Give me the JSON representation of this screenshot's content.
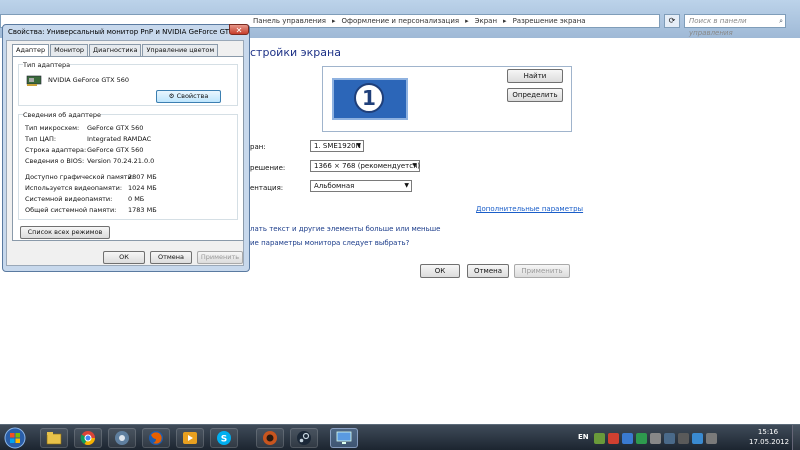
{
  "control_panel": {
    "breadcrumb": [
      "Панель управления",
      "Оформление и персонализация",
      "Экран",
      "Разрешение экрана"
    ],
    "search_placeholder": "Поиск в панели управления",
    "title": "стройки экрана",
    "identify_buttons": {
      "find": "Найти",
      "identify": "Определить"
    },
    "fields": [
      {
        "label": "ран:",
        "value": "1. SME1920N"
      },
      {
        "label": "решение:",
        "value": "1366 × 768 (рекомендуется)"
      },
      {
        "label": "ентация:",
        "value": "Альбомная"
      }
    ],
    "monitor_number": "1",
    "advanced_link": "Дополнительные параметры",
    "link_text_size": "лать текст и другие элементы больше или меньше",
    "link_which_params": "ие параметры монитора следует выбрать?",
    "buttons": {
      "ok": "ОК",
      "cancel": "Отмена",
      "apply": "Применить"
    }
  },
  "dialog": {
    "title": "Свойства: Универсальный монитор PnP и NVIDIA GeForce GTX",
    "close_glyph": "✕",
    "tabs": [
      "Адаптер",
      "Монитор",
      "Диагностика",
      "Управление цветом"
    ],
    "adapter_type_group": "Тип адаптера",
    "adapter_name": "NVIDIA GeForce GTX 560",
    "properties_button": "Свойства",
    "adapter_info_group": "Сведения об адаптере",
    "info": [
      {
        "label": "Тип микросхем:",
        "value": "GeForce GTX 560"
      },
      {
        "label": "Тип ЦАП:",
        "value": "Integrated RAMDAC"
      },
      {
        "label": "Строка адаптера:",
        "value": "GeForce GTX 560"
      },
      {
        "label": "Сведения о BIOS:",
        "value": "Version 70.24.21.0.0"
      }
    ],
    "memory": [
      {
        "label": "Доступно графической памяти:",
        "value": "2807 МБ"
      },
      {
        "label": "Используется видеопамяти:",
        "value": "1024 МБ"
      },
      {
        "label": "Системной видеопамяти:",
        "value": "0 МБ"
      },
      {
        "label": "Общей системной памяти:",
        "value": "1783 МБ"
      }
    ],
    "list_modes_button": "Список всех режимов",
    "buttons": {
      "ok": "ОК",
      "cancel": "Отмена",
      "apply": "Применить"
    }
  },
  "taskbar": {
    "pinned": [
      "windows-explorer-icon",
      "chrome-icon",
      "steam-like-icon",
      "firefox-icon",
      "media-player-icon",
      "skype-icon",
      "tf2-icon",
      "steam-icon",
      "display-settings-icon"
    ],
    "language": "EN",
    "time": "15:16",
    "date": "17.05.2012"
  }
}
